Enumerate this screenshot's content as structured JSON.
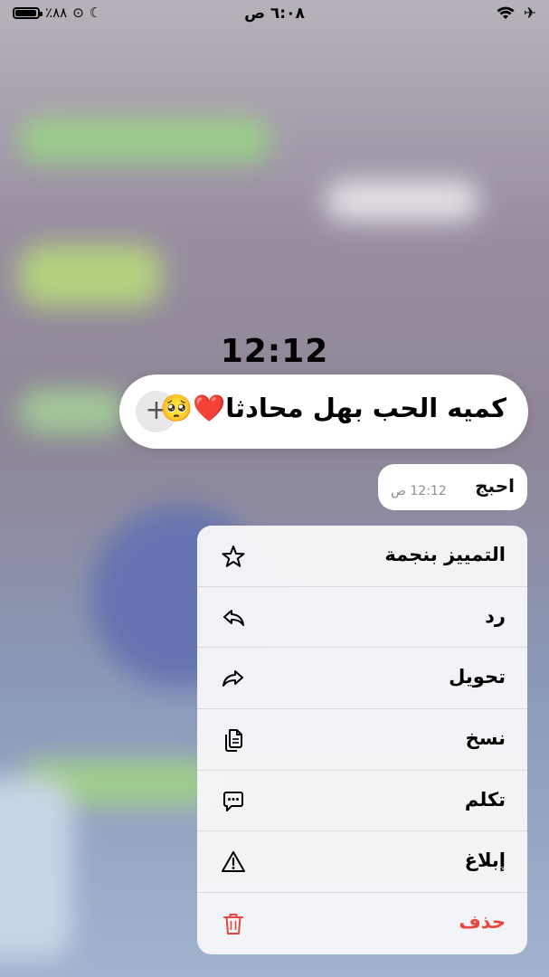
{
  "status_bar": {
    "time": "٦:٠٨ ص",
    "battery_percent": "٪٨٨",
    "battery_level": 0.88
  },
  "chat": {
    "timestamp_sticker": "12:12",
    "highlighted_message": "كميه الحب بهل محادثا❤️🥺",
    "message": {
      "text": "احبج",
      "time": "12:12 ص"
    }
  },
  "context_menu": {
    "items": [
      {
        "label": "التمييز بنجمة",
        "icon": "star-icon"
      },
      {
        "label": "رد",
        "icon": "reply-icon"
      },
      {
        "label": "تحويل",
        "icon": "forward-icon"
      },
      {
        "label": "نسخ",
        "icon": "copy-icon"
      },
      {
        "label": "تكلم",
        "icon": "speech-bubble-icon"
      },
      {
        "label": "إبلاغ",
        "icon": "warning-icon"
      },
      {
        "label": "حذف",
        "icon": "trash-icon"
      }
    ],
    "danger_color": "#e5463f"
  }
}
